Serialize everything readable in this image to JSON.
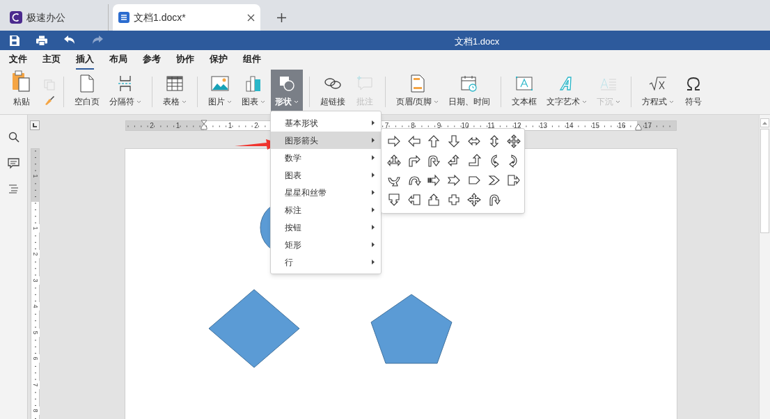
{
  "tabs": [
    {
      "kind": "app",
      "label": "极速办公",
      "selected": false
    },
    {
      "kind": "document",
      "label": "文档1.docx*",
      "selected": true
    }
  ],
  "title": "文档1.docx",
  "menu": [
    {
      "label": "文件",
      "selected": false
    },
    {
      "label": "主页",
      "selected": false
    },
    {
      "label": "插入",
      "selected": true
    },
    {
      "label": "布局",
      "selected": false
    },
    {
      "label": "参考",
      "selected": false
    },
    {
      "label": "协作",
      "selected": false
    },
    {
      "label": "保护",
      "selected": false
    },
    {
      "label": "组件",
      "selected": false
    }
  ],
  "toolbar": [
    [
      {
        "kind": "large",
        "label": "粘贴",
        "dropdown": false,
        "disabled": false,
        "open": false
      },
      {
        "kind": "small",
        "disabled": true,
        "open": false
      },
      {
        "kind": "small",
        "disabled": false,
        "open": false
      }
    ],
    [
      {
        "kind": "large",
        "label": "空白页",
        "dropdown": false,
        "disabled": false,
        "open": false
      },
      {
        "kind": "large",
        "label": "分隔符",
        "dropdown": true,
        "disabled": false,
        "open": false
      }
    ],
    [
      {
        "kind": "large",
        "label": "表格",
        "dropdown": true,
        "disabled": false,
        "open": false
      }
    ],
    [
      {
        "kind": "large",
        "label": "图片",
        "dropdown": true,
        "disabled": false,
        "open": false
      },
      {
        "kind": "large",
        "label": "图表",
        "dropdown": true,
        "disabled": false,
        "open": false
      },
      {
        "kind": "large",
        "label": "形状",
        "dropdown": true,
        "disabled": false,
        "open": true
      }
    ],
    [
      {
        "kind": "large",
        "label": "超链接",
        "dropdown": false,
        "disabled": false,
        "open": false
      },
      {
        "kind": "large",
        "label": "批注",
        "dropdown": false,
        "disabled": true,
        "open": false
      }
    ],
    [
      {
        "kind": "large",
        "label": "页眉/页脚",
        "dropdown": true,
        "disabled": false,
        "open": false
      },
      {
        "kind": "large",
        "label": "日期、时间",
        "dropdown": false,
        "disabled": false,
        "open": false
      }
    ],
    [
      {
        "kind": "large",
        "label": "文本框",
        "dropdown": false,
        "disabled": false,
        "open": false
      },
      {
        "kind": "large",
        "label": "文字艺术",
        "dropdown": true,
        "disabled": false,
        "open": false
      },
      {
        "kind": "large",
        "label": "下沉",
        "dropdown": true,
        "disabled": true,
        "open": false
      }
    ],
    [
      {
        "kind": "large",
        "label": "方程式",
        "dropdown": true,
        "disabled": false,
        "open": false
      },
      {
        "kind": "large",
        "label": "符号",
        "dropdown": false,
        "disabled": false,
        "open": false
      }
    ]
  ],
  "ruler": {
    "horizontal": [
      {
        "label": "2"
      },
      {
        "label": "1"
      },
      {
        "label": "1"
      },
      {
        "label": "2"
      },
      {
        "label": "7"
      },
      {
        "label": "8"
      },
      {
        "label": "9"
      },
      {
        "label": "10"
      },
      {
        "label": "11"
      },
      {
        "label": "12"
      },
      {
        "label": "13"
      },
      {
        "label": "14"
      },
      {
        "label": "15"
      },
      {
        "label": "16"
      },
      {
        "label": "17"
      }
    ],
    "vertical": [
      {
        "label": "1"
      },
      {
        "label": "1"
      },
      {
        "label": "2"
      },
      {
        "label": "3"
      },
      {
        "label": "4"
      },
      {
        "label": "5"
      },
      {
        "label": "6"
      },
      {
        "label": "7"
      },
      {
        "label": "8"
      }
    ]
  },
  "document_shapes": [
    {
      "kind": "circle"
    },
    {
      "kind": "diamond"
    },
    {
      "kind": "pentagon"
    }
  ],
  "shape_menu": {
    "items": [
      {
        "label": "基本形状",
        "selected": false
      },
      {
        "label": "图形箭头",
        "selected": true
      },
      {
        "label": "数学",
        "selected": false
      },
      {
        "label": "图表",
        "selected": false
      },
      {
        "label": "星星和丝带",
        "selected": false
      },
      {
        "label": "标注",
        "selected": false
      },
      {
        "label": "按钮",
        "selected": false
      },
      {
        "label": "矩形",
        "selected": false
      },
      {
        "label": "行",
        "selected": false
      }
    ],
    "submenu_shapes": [
      {
        "kind": "right"
      },
      {
        "kind": "left"
      },
      {
        "kind": "up"
      },
      {
        "kind": "down"
      },
      {
        "kind": "left-right"
      },
      {
        "kind": "up-down"
      },
      {
        "kind": "quad"
      },
      {
        "kind": "left-right-up"
      },
      {
        "kind": "bent"
      },
      {
        "kind": "u-turn"
      },
      {
        "kind": "left-up"
      },
      {
        "kind": "bent-up"
      },
      {
        "kind": "curved-right"
      },
      {
        "kind": "curved-left"
      },
      {
        "kind": "curved-up"
      },
      {
        "kind": "curved-down"
      },
      {
        "kind": "striped"
      },
      {
        "kind": "notched"
      },
      {
        "kind": "pentagon"
      },
      {
        "kind": "chevron"
      },
      {
        "kind": "right-callout"
      },
      {
        "kind": "down-callout"
      },
      {
        "kind": "left-callout"
      },
      {
        "kind": "up-callout"
      },
      {
        "kind": "cross"
      },
      {
        "kind": "quad-star"
      },
      {
        "kind": "circular"
      }
    ]
  }
}
